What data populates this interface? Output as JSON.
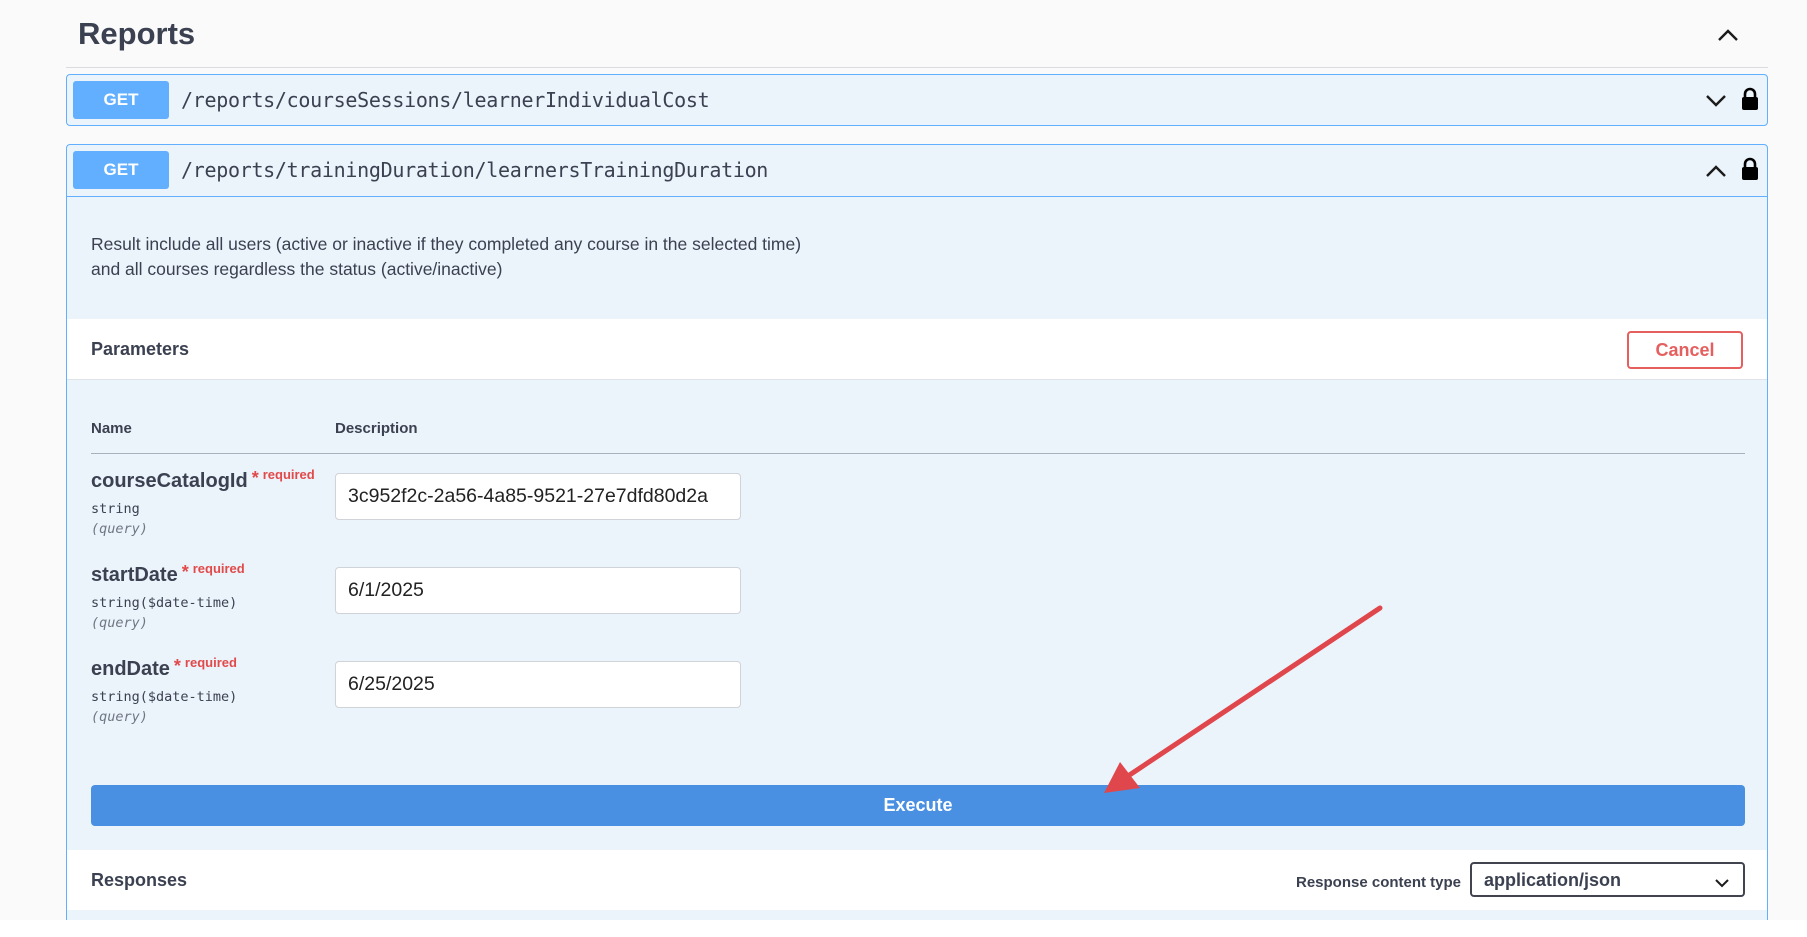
{
  "section": {
    "title": "Reports"
  },
  "operations": [
    {
      "method": "GET",
      "path": "/reports/courseSessions/learnerIndividualCost"
    },
    {
      "method": "GET",
      "path": "/reports/trainingDuration/learnersTrainingDuration",
      "description": [
        "Result include all users (active or inactive if they completed any course in the selected time)",
        "and all courses regardless the status (active/inactive)"
      ],
      "parameters_title": "Parameters",
      "cancel_label": "Cancel",
      "columns": {
        "name": "Name",
        "description": "Description"
      },
      "params": [
        {
          "name": "courseCatalogId",
          "star": "*",
          "required": "required",
          "type": "string",
          "in": "(query)",
          "value": "3c952f2c-2a56-4a85-9521-27e7dfd80d2a"
        },
        {
          "name": "startDate",
          "star": "*",
          "required": "required",
          "type": "string($date-time)",
          "in": "(query)",
          "value": "6/1/2025"
        },
        {
          "name": "endDate",
          "star": "*",
          "required": "required",
          "type": "string($date-time)",
          "in": "(query)",
          "value": "6/25/2025"
        }
      ],
      "execute_label": "Execute",
      "responses_title": "Responses",
      "response_content_type_label": "Response content type",
      "response_content_type_value": "application/json"
    }
  ],
  "colors": {
    "get_method": "#61affe",
    "execute": "#4990e2",
    "cancel": "#e65f5f",
    "annotation_arrow": "#e0474c"
  },
  "icons": [
    "chevron-up-icon",
    "chevron-down-icon",
    "lock-icon"
  ]
}
